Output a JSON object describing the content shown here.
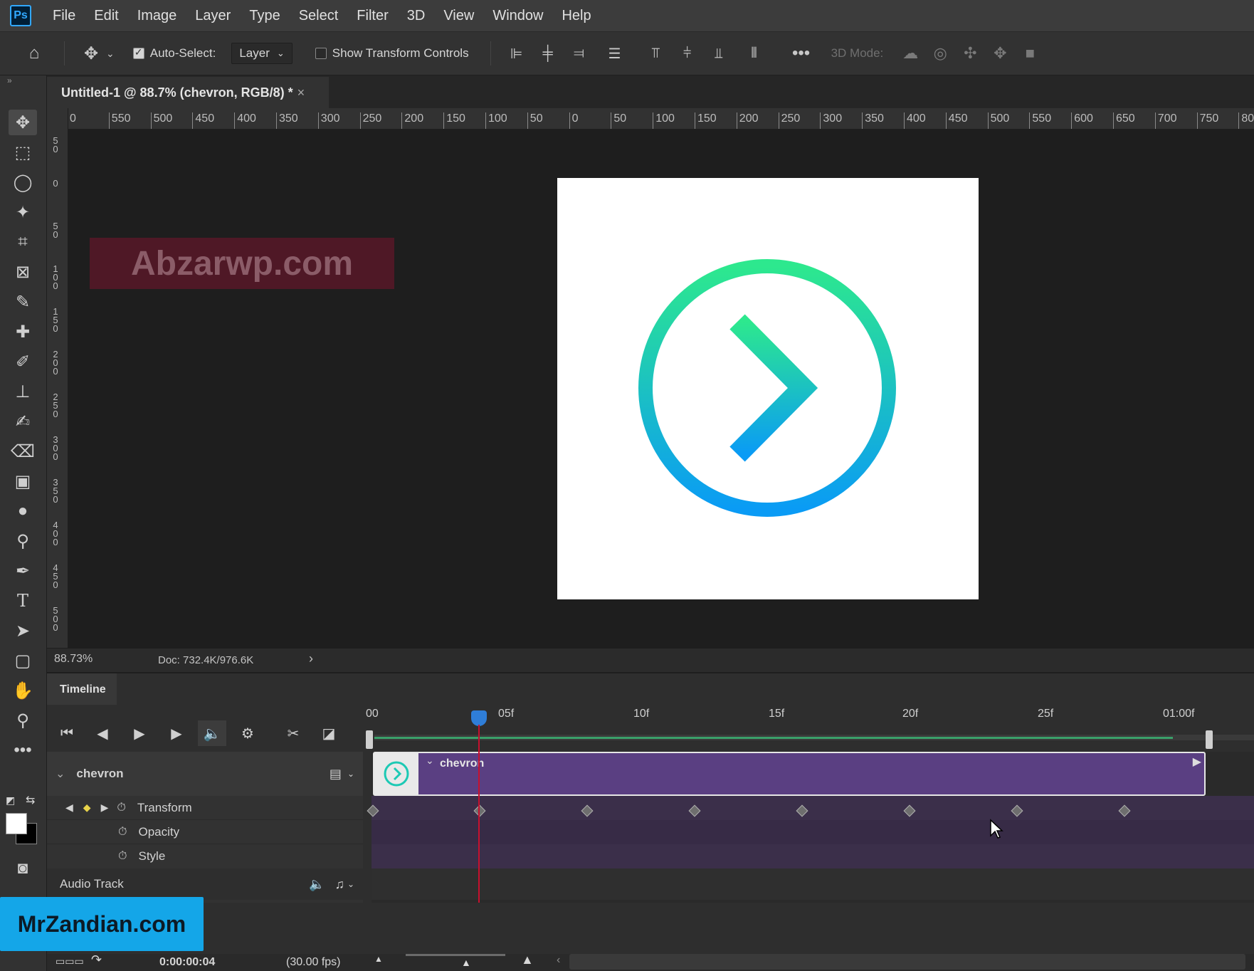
{
  "app": {
    "logo_text": "Ps"
  },
  "menu": [
    "File",
    "Edit",
    "Image",
    "Layer",
    "Type",
    "Select",
    "Filter",
    "3D",
    "View",
    "Window",
    "Help"
  ],
  "options": {
    "auto_select_label": "Auto-Select:",
    "auto_select_value": "Layer",
    "show_transform_label": "Show Transform Controls",
    "mode_3d_label": "3D Mode:"
  },
  "document": {
    "tab_title": "Untitled-1 @ 88.7% (chevron, RGB/8) *",
    "zoom": "88.73%",
    "doc_info": "Doc: 732.4K/976.6K"
  },
  "ruler_top": [
    "0",
    "550",
    "500",
    "450",
    "400",
    "350",
    "300",
    "250",
    "200",
    "150",
    "100",
    "50",
    "0",
    "50",
    "100",
    "150",
    "200",
    "250",
    "300",
    "350",
    "400",
    "450",
    "500",
    "550",
    "600",
    "650",
    "700",
    "750",
    "800"
  ],
  "ruler_left": [
    "5 0",
    "0",
    "5 0",
    "1 0 0",
    "1 5 0",
    "2 0 0",
    "2 5 0",
    "3 0 0",
    "3 5 0",
    "4 0 0",
    "4 5 0",
    "5 0 0"
  ],
  "watermarks": {
    "top": "Abzarwp.com",
    "bottom": "MrZandian.com"
  },
  "timeline": {
    "title": "Timeline",
    "layer_name": "chevron",
    "clip_name": "chevron",
    "properties": [
      "Transform",
      "Opacity",
      "Style"
    ],
    "audio_track": "Audio Track",
    "time_ticks": [
      "00",
      "05f",
      "10f",
      "15f",
      "20f",
      "25f",
      "01:00f"
    ],
    "current_time": "0:00:00:04",
    "fps": "(30.00 fps)",
    "current_frame": 4,
    "total_frames": 30
  },
  "colors": {
    "accent": "#31a8ff",
    "clip": "#5a3f82",
    "playhead": "#c8102e",
    "gradient_top": "#2de88e",
    "gradient_bottom": "#0a9bf5"
  }
}
